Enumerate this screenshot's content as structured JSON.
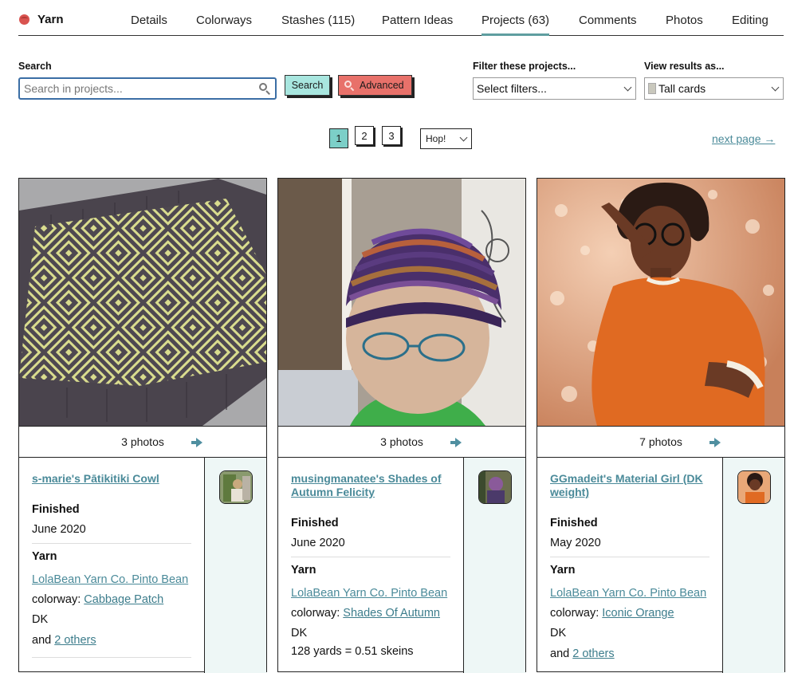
{
  "nav": {
    "brand": "Yarn",
    "tabs": [
      "Details",
      "Colorways",
      "Stashes (115)",
      "Pattern Ideas",
      "Projects (63)",
      "Comments",
      "Photos",
      "Editing"
    ]
  },
  "search": {
    "label": "Search",
    "placeholder": "Search in projects...",
    "value": "",
    "search_button": "Search",
    "advanced_button": "Advanced"
  },
  "filter": {
    "label": "Filter these projects...",
    "value": "Select filters..."
  },
  "view": {
    "label": "View results as...",
    "value": "Tall cards"
  },
  "pagination": {
    "pages": [
      "1",
      "2",
      "3"
    ],
    "current": "1",
    "hop_label": "Hop!",
    "next_label": "next page →"
  },
  "colors": {
    "accent": "#5f9ea0",
    "link": "#3d7d8c",
    "search_button": "#a8e6df",
    "advanced_button": "#e8716a",
    "side_panel": "#eef7f6"
  },
  "cards": [
    {
      "title": "s-marie's Pātikitiki Cowl",
      "photos": "3 photos",
      "status_label": "Finished",
      "date": "June 2020",
      "yarn_label": "Yarn",
      "yarn_link": "LolaBean Yarn Co. Pinto Bean",
      "colorway_prefix": "colorway:",
      "colorway": "Cabbage Patch",
      "weight": "DK",
      "extra_prefix": "and",
      "extra": "2 others"
    },
    {
      "title": "musingmanatee's Shades of Autumn Felicity",
      "photos": "3 photos",
      "status_label": "Finished",
      "date": "June 2020",
      "yarn_label": "Yarn",
      "yarn_link": "LolaBean Yarn Co. Pinto Bean",
      "colorway_prefix": "colorway:",
      "colorway": "Shades Of Autumn",
      "weight": "DK",
      "yardage": "128 yards = 0.51 skeins"
    },
    {
      "title": "GGmadeit's Material Girl (DK weight)",
      "photos": "7 photos",
      "status_label": "Finished",
      "date": "May 2020",
      "yarn_label": "Yarn",
      "yarn_link": "LolaBean Yarn Co. Pinto Bean",
      "colorway_prefix": "colorway:",
      "colorway": "Iconic Orange",
      "weight": "DK",
      "extra_prefix": "and",
      "extra": "2 others"
    }
  ]
}
